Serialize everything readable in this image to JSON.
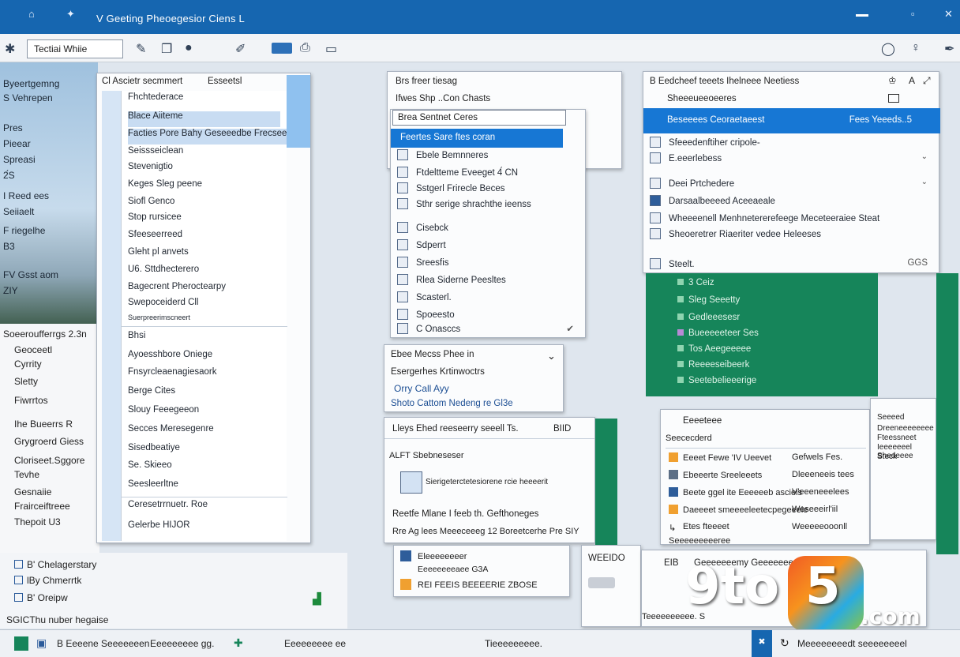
{
  "titlebar": {
    "title": "V Geeting Pheoegesior Ciens L"
  },
  "toolbar": {
    "address": "Tectiai Whiie"
  },
  "sky_labels": [
    "Byeertgemng",
    "S Vehrepen",
    "Pres",
    "Pieear",
    "Spreasi",
    "2́S",
    "I Reed ees",
    "Seiiaelt",
    "F riegelhe",
    "B3",
    "FV  Gsst aom",
    "ZIY"
  ],
  "left_lower": [
    "Soeeroufferrgs 2.3n",
    "Geoceetl",
    "Cyrrity",
    "Sletty",
    "Fiwrrtos",
    "Ihe Bueerrs R",
    "Grygroerd Giess",
    "Cloriseet.Sggore",
    "Tevhe",
    "Gesnaiie",
    "Frairceiftreee",
    "Thepoit U3"
  ],
  "bottom_left": [
    "B' Chelagerstary",
    "lBy Chmerrtk",
    "B' Oreipw",
    "SGICThu nuber hegaise"
  ],
  "panel_a": {
    "header": "Cl Ascietr secmmert",
    "header2": "Esseetsl",
    "items": [
      "Fhchtederace",
      "Blace Aiiteme",
      "Facties Pore Bahy Geseeedbe Frecseetie",
      "Seissseiclean",
      "Stevenigtio",
      "Keges Sleg peene",
      "Siofl Genco",
      "Stop rursicee",
      "Sfeeseerreed",
      "Gleht pl anvets",
      "U6. Sttdhecterero",
      "Bagecrent Pheroctearpy",
      "Swepoceiderd Cll",
      "Suerpreerimscneert",
      "Bhsi",
      "Ayoesshbore Oniege",
      "Fnsyrcleaenagiesaork",
      "Berge Cites",
      "Slouy Feeegeeon",
      "Secces Meresegenre",
      "Sisedbeatiye",
      "Se. Skieeo",
      "Seesleerltne",
      "Ceresetrrnuetr. Roe",
      "Gelerbe  HIJOR"
    ]
  },
  "panel_b": {
    "header": "Brs freer tiesag",
    "header2": "Ifwes Shp  ..Con Chasts",
    "search": "Brea Sentnet Ceres",
    "items": [
      "Feertes  Sare ftes coran",
      "Ebele Bemnneres",
      "Ftdeltteme Eveeget 4́ CN",
      "Sstgerl Frirecle Beces",
      "Sthr  serige shrachthe ieenss",
      "Cisebck",
      "Sdperrt",
      "Sreesfis",
      "Rlea Siderne Peesltes",
      "Scasterl.",
      "Spoeesto",
      "C Onasccs"
    ],
    "sub_header": "Ebee Mecss Phee in",
    "sub_items": [
      "Esergerhes Krtinwoctrs",
      "Orry Call  Ayy",
      "Shoto Cattom Nedeng re Gl3e"
    ],
    "lower_header": "Lleys Ehed reeseerry seeell Ts.",
    "lower_badge": "BIID",
    "lower_items": [
      "ALFT Sbebneseser",
      "Sierigeterctetesiorene rcie heeeerit",
      "Reetfe Mlane  I feeb th. Gefthoneges",
      "Rre Ag  lees Meeeceeeg 12 Boreetcerhe Pre  SIY"
    ]
  },
  "panel_c": {
    "header": "B Eedcheef teeets Ihelneee Neetiess",
    "header2": "Sheeeueeoeeres",
    "selected": "Beseeees Ceoraetaeest",
    "selected_right": "Fees Yeeeds..5",
    "items": [
      "Sfeeedenftiher cripole-",
      "E.eeerlebess",
      "Deei Prtchedere",
      "Darsaalbeeeed  Aceeaeale",
      "Wheeeenell Menhnetererefeege Meceteeraiee Steat",
      "Sheoeretrer Riaeriter vedee Heleeses",
      "Steelt."
    ],
    "count": "GGS",
    "green_items": [
      "3 Ceiz",
      "Sleg  Seeetty",
      "Gedleeesesr",
      "Bueeeeeteer Ses",
      "Tos  Aeegeeeee",
      "Reeeeseibeerk",
      "Seetebelieeerige"
    ]
  },
  "panel_d": {
    "header": "Eeeeteee",
    "header2": "Seececderd",
    "items": [
      {
        "left": "Eeeet Fewe 'IV Ueevet",
        "right": "Gefwels Fes."
      },
      {
        "left": "Ebeeerte  Sreeleeets",
        "right": "Dleeeneeis tees"
      },
      {
        "left": "Beete ggel ite Eeeeeeb ascieis",
        "right": "V'eeeneeelees"
      },
      {
        "left": "Daeeeet smeeeeleetecpegeeeie",
        "right": "Weseeeirl'iil"
      },
      {
        "left": "Etes fteeeet",
        "right": "Weeeeeooonll"
      },
      {
        "left": "Seeeeeeeeeree",
        "right": ""
      }
    ],
    "side_items": [
      "Seeeed",
      "Dreeneeeeeeee",
      "Fteessneet",
      "Ieeeeeeel Shedeeee",
      "Steck"
    ]
  },
  "bottom_center": {
    "items": [
      "Eleeeeeeeer",
      "Eeeeeeeeaee G3A",
      "REI FEEIS BEEEERIE ZBOSE"
    ],
    "tag": "WEEIDO"
  },
  "bottom_right": {
    "items": [
      "EIB",
      "Geeeeeeemy  Geeeeeeeeteeeeeee"
    ],
    "bottom": "Teeeeeeeeee. S"
  },
  "status": {
    "left": "B  Eeeene Seeeeeeen",
    "mid1": "Eeeeeeeee gg.",
    "mid2": "Eeeeeeeee ee",
    "center": "Tieeeeeeeee.",
    "right": "Meeeeeeeedt seeeeeeeel"
  },
  "logo": {
    "text1": "9to",
    "text2": "5",
    "text3": ".com"
  },
  "colors": {
    "titlebar": "#1666b0",
    "selection": "#1777d4",
    "green": "#16855a"
  }
}
